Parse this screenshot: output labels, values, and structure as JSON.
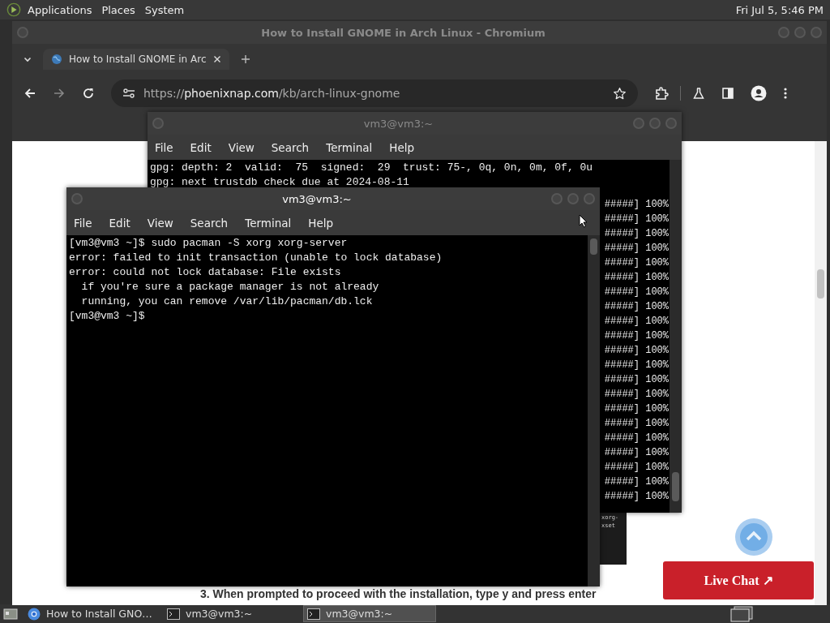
{
  "top_panel": {
    "menus": [
      "Applications",
      "Places",
      "System"
    ],
    "clock": "Fri Jul 5, 5:46 PM"
  },
  "browser": {
    "title": "How to Install GNOME in Arch Linux - Chromium",
    "active": false,
    "tabs": [
      {
        "label": "How to Install GNOME in Arc",
        "selected": true
      }
    ],
    "address": {
      "scheme": "https://",
      "domain": "phoenixnap.com",
      "path": "/kb/arch-linux-gnome"
    },
    "page": {
      "embedded_lines": [
        "xorg-",
        "xset"
      ],
      "step_text": "3. When prompted to proceed with the installation, type y and press enter",
      "chat_button": "Live Chat ↗"
    }
  },
  "terminals": [
    {
      "title": "vm3@vm3:~",
      "active": false,
      "menus": [
        "File",
        "Edit",
        "View",
        "Search",
        "Terminal",
        "Help"
      ],
      "lines": [
        "gpg: depth: 2  valid:  75  signed:  29  trust: 75-, 0q, 0n, 0m, 0f, 0u",
        "gpg: next trustdb check due at 2024-08-11"
      ],
      "right_lines": [
        "#####] 100%",
        "#####] 100%",
        "#####] 100%",
        "#####] 100%",
        "#####] 100%",
        "#####] 100%",
        "#####] 100%",
        "#####] 100%",
        "#####] 100%",
        "#####] 100%",
        "#####] 100%",
        "#####] 100%",
        "#####] 100%",
        "#####] 100%",
        "#####] 100%",
        "#####] 100%",
        "#####] 100%",
        "#####] 100%",
        "#####] 100%",
        "#####] 100%",
        "#####] 100%"
      ]
    },
    {
      "title": "vm3@vm3:~",
      "active": true,
      "menus": [
        "File",
        "Edit",
        "View",
        "Search",
        "Terminal",
        "Help"
      ],
      "lines": [
        "[vm3@vm3 ~]$ sudo pacman -S xorg xorg-server",
        "error: failed to init transaction (unable to lock database)",
        "error: could not lock database: File exists",
        "  if you're sure a package manager is not already",
        "  running, you can remove /var/lib/pacman/db.lck",
        "[vm3@vm3 ~]$"
      ]
    }
  ],
  "taskbar": {
    "items": [
      {
        "kind": "browser",
        "label": "How to Install GNO…",
        "selected": false
      },
      {
        "kind": "terminal",
        "label": "vm3@vm3:~",
        "selected": false
      },
      {
        "kind": "terminal",
        "label": "vm3@vm3:~",
        "selected": true
      }
    ]
  }
}
